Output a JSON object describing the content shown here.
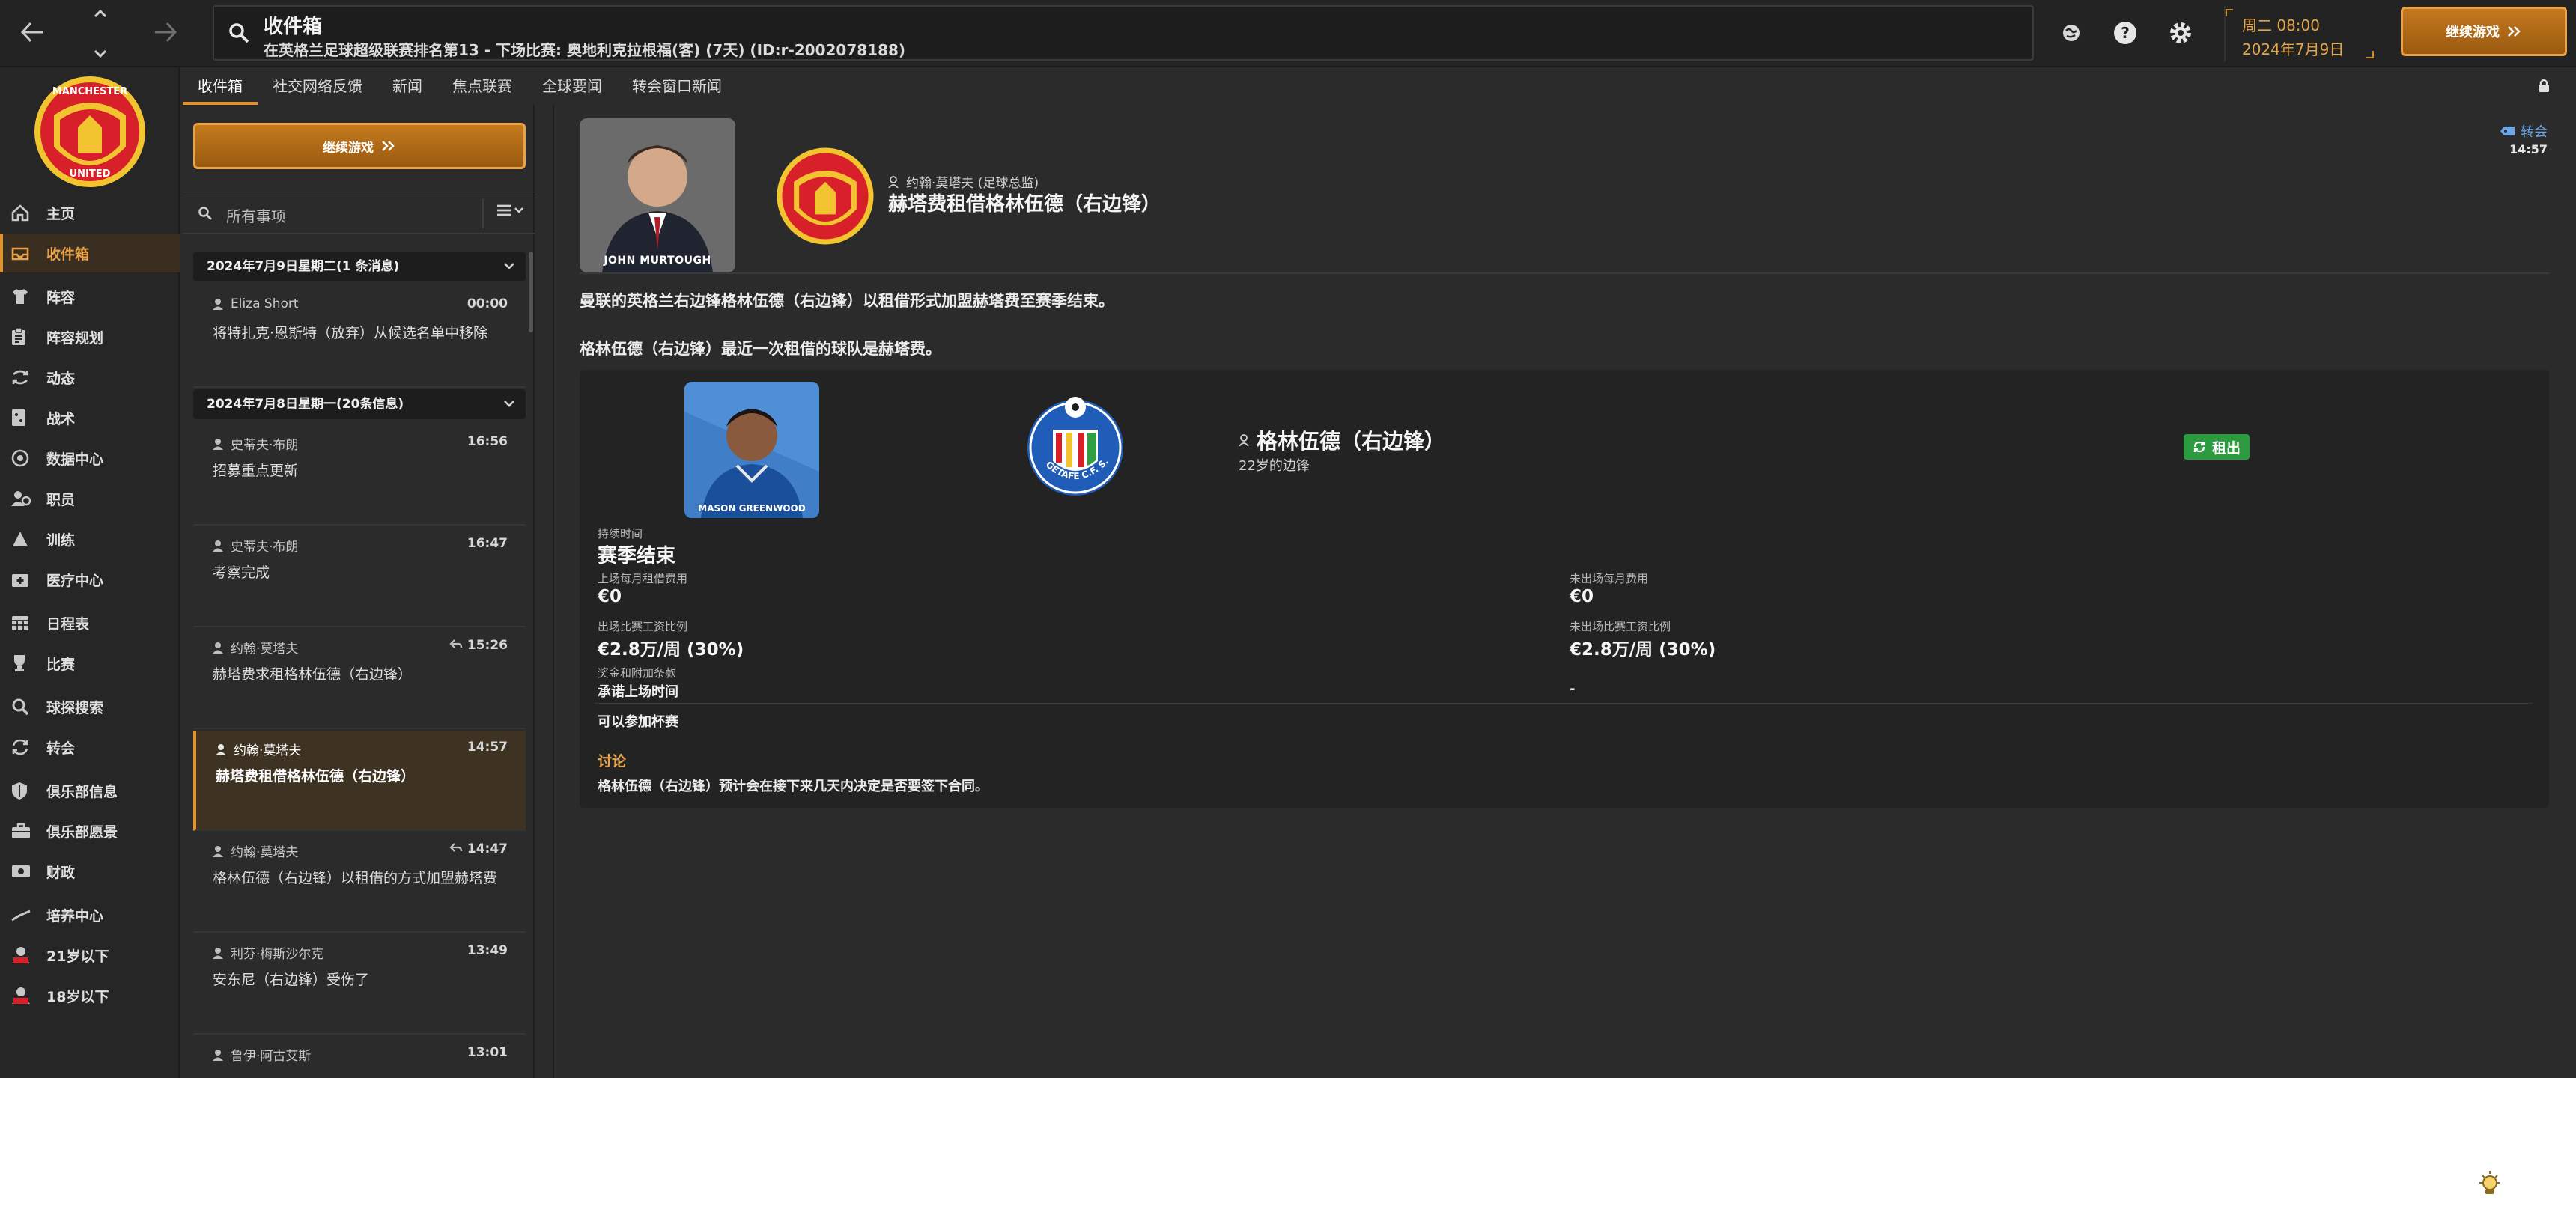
{
  "topbar": {
    "title": "收件箱",
    "subtitle": "在英格兰足球超级联赛排名第13 - 下场比赛: 奥地利克拉根福(客) (7天) (ID:r-2002078188)",
    "date_day": "周二 08:00",
    "date": "2024年7月9日",
    "continue_label": "继续游戏"
  },
  "subtabs": [
    "收件箱",
    "社交网络反馈",
    "新闻",
    "焦点联赛",
    "全球要闻",
    "转会窗口新闻"
  ],
  "sidebar": {
    "items": [
      {
        "label": "主页",
        "icon": "home-icon"
      },
      {
        "label": "收件箱",
        "icon": "inbox-icon",
        "active": true
      },
      {
        "label": "阵容",
        "icon": "shirt-icon"
      },
      {
        "label": "阵容规划",
        "icon": "clipboard-icon"
      },
      {
        "label": "动态",
        "icon": "dynamics-icon"
      },
      {
        "label": "战术",
        "icon": "tactics-icon"
      },
      {
        "label": "数据中心",
        "icon": "data-icon"
      },
      {
        "label": "职员",
        "icon": "staff-icon"
      },
      {
        "label": "训练",
        "icon": "training-icon"
      },
      {
        "label": "医疗中心",
        "icon": "medical-icon"
      },
      {
        "label": "日程表",
        "icon": "calendar-icon"
      },
      {
        "label": "比赛",
        "icon": "trophy-icon"
      },
      {
        "label": "球探搜索",
        "icon": "search-icon"
      },
      {
        "label": "转会",
        "icon": "transfer-icon"
      },
      {
        "label": "俱乐部信息",
        "icon": "shield-icon"
      },
      {
        "label": "俱乐部愿景",
        "icon": "briefcase-icon"
      },
      {
        "label": "财政",
        "icon": "money-icon"
      },
      {
        "label": "培养中心",
        "icon": "development-icon"
      },
      {
        "label": "21岁以下",
        "icon": "u21-icon"
      },
      {
        "label": "18岁以下",
        "icon": "u18-icon"
      }
    ]
  },
  "inbox": {
    "continue_label": "继续游戏",
    "search_placeholder": "所有事项",
    "groups": [
      {
        "label": "2024年7月9日星期二(1 条消息)"
      },
      {
        "label": "2024年7月8日星期一(20条信息)"
      }
    ],
    "messages": [
      {
        "sender": "Eliza Short",
        "time": "00:00",
        "subject": "将特扎克·恩斯特（放弃）从候选名单中移除"
      },
      {
        "sender": "史蒂夫·布朗",
        "time": "16:56",
        "subject": "招募重点更新"
      },
      {
        "sender": "史蒂夫·布朗",
        "time": "16:47",
        "subject": "考察完成"
      },
      {
        "sender": "约翰·莫塔夫",
        "time": "15:26",
        "subject": "赫塔费求租格林伍德（右边锋）"
      },
      {
        "sender": "约翰·莫塔夫",
        "time": "14:57",
        "subject": "赫塔费租借格林伍德（右边锋）"
      },
      {
        "sender": "约翰·莫塔夫",
        "time": "14:47",
        "subject": "格林伍德（右边锋）以租借的方式加盟赫塔费"
      },
      {
        "sender": "利芬·梅斯沙尔克",
        "time": "13:49",
        "subject": "安东尼（右边锋）受伤了"
      },
      {
        "sender": "鲁伊·阿古艾斯",
        "time": "13:01",
        "subject": ""
      }
    ]
  },
  "message": {
    "photo_caption": "JOHN MURTOUGH",
    "author": "约翰·莫塔夫 (足球总监)",
    "title": "赫塔费租借格林伍德（右边锋）",
    "tag": "转会",
    "time": "14:57",
    "body1": "曼联的英格兰右边锋格林伍德（右边锋）以租借形式加盟赫塔费至赛季结束。",
    "body2": "格林伍德（右边锋）最近一次租借的球队是赫塔费。",
    "club_logo_text": "MANCHESTER UNITED"
  },
  "card": {
    "player_caption": "MASON GREENWOOD",
    "getafe_text": "GETAFE C.F. S.A.D.",
    "player_name": "格林伍德（右边锋）",
    "player_desc": "22岁的边锋",
    "badge": "租出",
    "duration_label": "持续时间",
    "duration_value": "赛季结束",
    "fee_played_label": "上场每月租借费用",
    "fee_played_value": "€0",
    "fee_unplayed_label": "未出场每月费用",
    "fee_unplayed_value": "€0",
    "wage_played_label": "出场比赛工资比例",
    "wage_played_value": "€2.8万/周 (30%)",
    "wage_unplayed_label": "未出场比赛工资比例",
    "wage_unplayed_value": "€2.8万/周 (30%)",
    "bonus_label": "奖金和附加条款",
    "promise_label": "承诺上场时间",
    "promise_value": "-",
    "cup_label": "可以参加杯赛",
    "discuss_heading": "讨论",
    "discuss_body": "格林伍德（右边锋）预计会在接下来几天内决定是否要签下合同。"
  },
  "colors": {
    "accent": "#e0922d",
    "background": "#2b2b2b",
    "loan_badge": "#2c9a3f",
    "link": "#6aa6e8"
  }
}
